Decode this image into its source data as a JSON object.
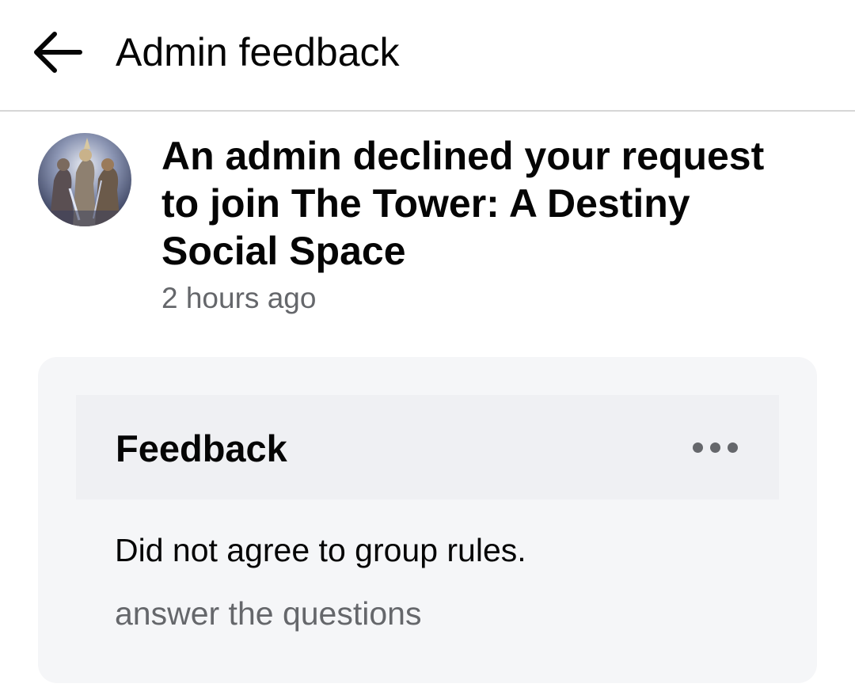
{
  "header": {
    "title": "Admin feedback",
    "back_icon": "arrow-left-icon"
  },
  "notification": {
    "avatar_icon": "group-avatar",
    "message": "An admin declined your request to join The Tower: A Destiny Social Space",
    "time": "2 hours ago"
  },
  "feedback": {
    "title": "Feedback",
    "more_icon": "more-horizontal-icon",
    "reason": "Did not agree to group rules.",
    "note": "answer the questions"
  },
  "colors": {
    "text_primary": "#050505",
    "text_secondary": "#65676b",
    "card_bg": "#f5f6f8",
    "card_header_bg": "#eff0f3",
    "divider": "#d6d6d6"
  }
}
